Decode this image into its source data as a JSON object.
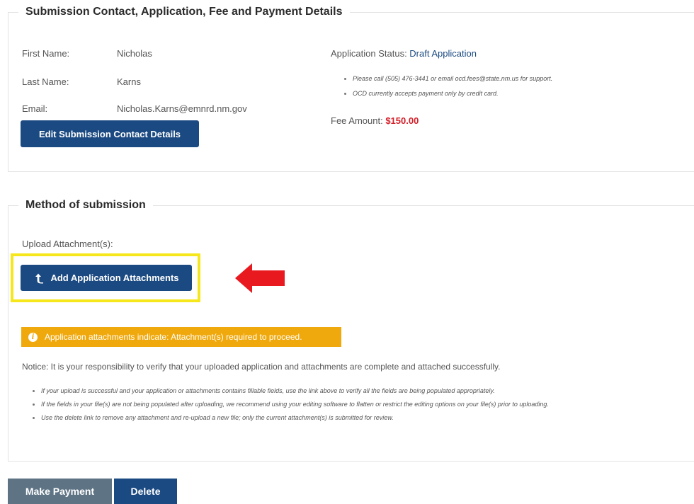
{
  "contact_section": {
    "legend": "Submission Contact, Application, Fee and Payment Details",
    "first_name_label": "First Name:",
    "first_name_value": "Nicholas",
    "last_name_label": "Last Name:",
    "last_name_value": "Karns",
    "email_label": "Email:",
    "email_value": "Nicholas.Karns@emnrd.nm.gov",
    "edit_button_label": "Edit Submission Contact Details",
    "status_label": "Application Status: ",
    "status_value": "Draft Application",
    "notes": [
      "Please call (505) 476-3441 or email ocd.fees@state.nm.us for support.",
      "OCD currently accepts payment only by credit card."
    ],
    "fee_label": "Fee Amount: ",
    "fee_value": "$150.00"
  },
  "method_section": {
    "legend": "Method of submission",
    "upload_label": "Upload Attachment(s):",
    "add_button_label": "Add Application Attachments",
    "warning_text": "Application attachments indicate: Attachment(s) required to proceed.",
    "notice_text": "Notice: It is your responsibility to verify that your uploaded application and attachments are complete and attached successfully.",
    "notice_items": [
      "If your upload is successful and your application or attachments contains fillable fields, use the link above to verify all the fields are being populated appropriately.",
      "If the fields in your file(s) are not being populated after uploading, we recommend using your editing software to flatten or restrict the editing options on your file(s) prior to uploading.",
      "Use the delete link to remove any attachment and re-upload a new file; only the current attachment(s) is submitted for review."
    ]
  },
  "footer": {
    "make_payment_label": "Make Payment",
    "delete_label": "Delete"
  },
  "icons": {
    "upload": "upload-arrow-icon",
    "info": "info-icon",
    "annotation": "red-arrow-icon"
  },
  "colors": {
    "primary": "#1b4a82",
    "fee": "#d4202a",
    "warning": "#f0a90d",
    "highlight": "#f6e61c",
    "annotation_arrow": "#e8191f",
    "disabled_button": "#5e7384"
  }
}
